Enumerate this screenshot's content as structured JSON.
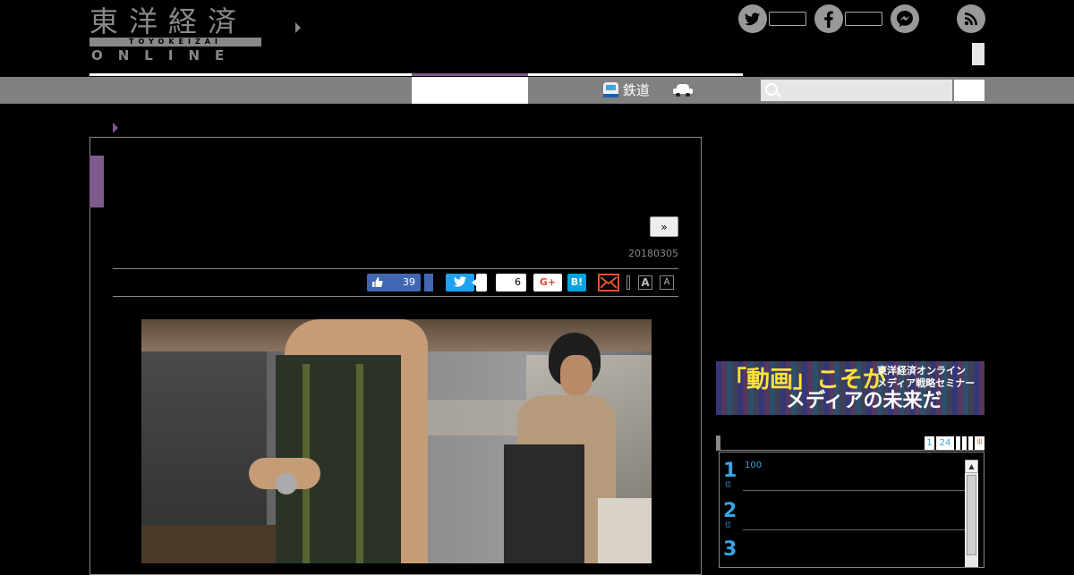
{
  "logo": {
    "kanji": "東洋経済",
    "romaji": "TOYOKEIZAI",
    "online": "ONLINE"
  },
  "nav": {
    "items": [
      {
        "label": "鉄道",
        "icon": "train-icon"
      },
      {
        "label": "",
        "icon": "car-icon"
      }
    ]
  },
  "search": {
    "placeholder": ""
  },
  "article": {
    "next_label": "»",
    "date": "20180305",
    "share": {
      "facebook_count": "39",
      "pocket_count": "6",
      "gplus_label": "G+",
      "hatena_label": "B!",
      "font_large": "A",
      "font_small": "A"
    }
  },
  "sidebar": {
    "banner": {
      "headline": "「動画」こそが",
      "subtitle_1": "東洋経済オンライン",
      "subtitle_2": "メディア戦略セミナー",
      "tagline": "メディアの未来だ"
    },
    "ranking": {
      "tabs": [
        "1",
        "24"
      ],
      "items": [
        {
          "rank": "1",
          "text": "100"
        },
        {
          "rank": "2",
          "text": ""
        },
        {
          "rank": "3",
          "text": ""
        }
      ]
    }
  },
  "colors": {
    "accent": "#7e5a8c",
    "nav_gray": "#808080",
    "rank_blue": "#3aa4e5"
  }
}
